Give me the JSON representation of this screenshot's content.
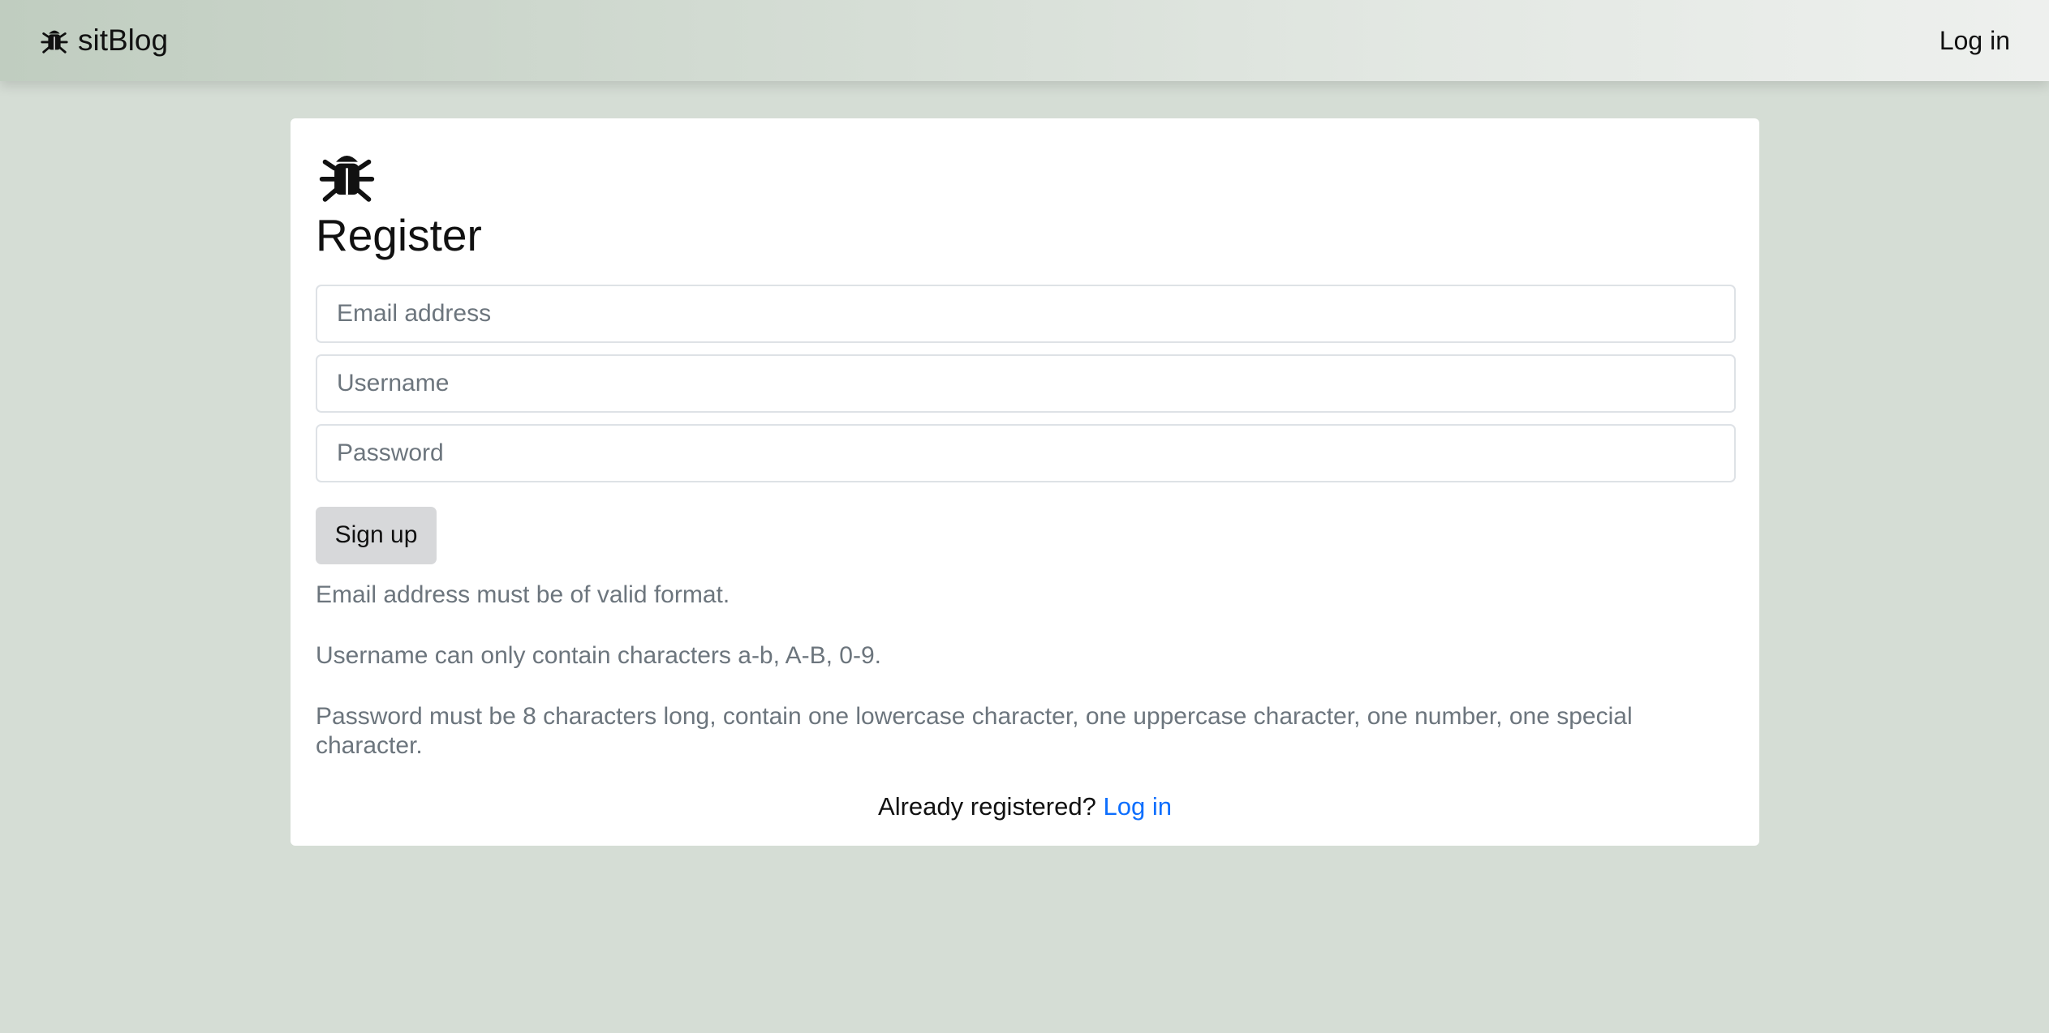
{
  "navbar": {
    "brand_icon": "bug-icon",
    "brand_label": "sitBlog",
    "login_label": "Log in"
  },
  "register_card": {
    "icon": "bug-icon",
    "title": "Register",
    "fields": {
      "email_placeholder": "Email address",
      "username_placeholder": "Username",
      "password_placeholder": "Password"
    },
    "signup_label": "Sign up",
    "hints": [
      "Email address must be of valid format.",
      "Username can only contain characters a-b, A-B, 0-9.",
      "Password must be 8 characters long, contain one lowercase character, one uppercase character, one number, one special character."
    ],
    "footer": {
      "prompt": "Already registered?",
      "login_link": "Log in"
    }
  },
  "colors": {
    "background": "#d5ddd5",
    "card": "#ffffff",
    "link": "#0d6efd",
    "hint_text": "#6c757d",
    "button_bg": "#d7d8da"
  }
}
